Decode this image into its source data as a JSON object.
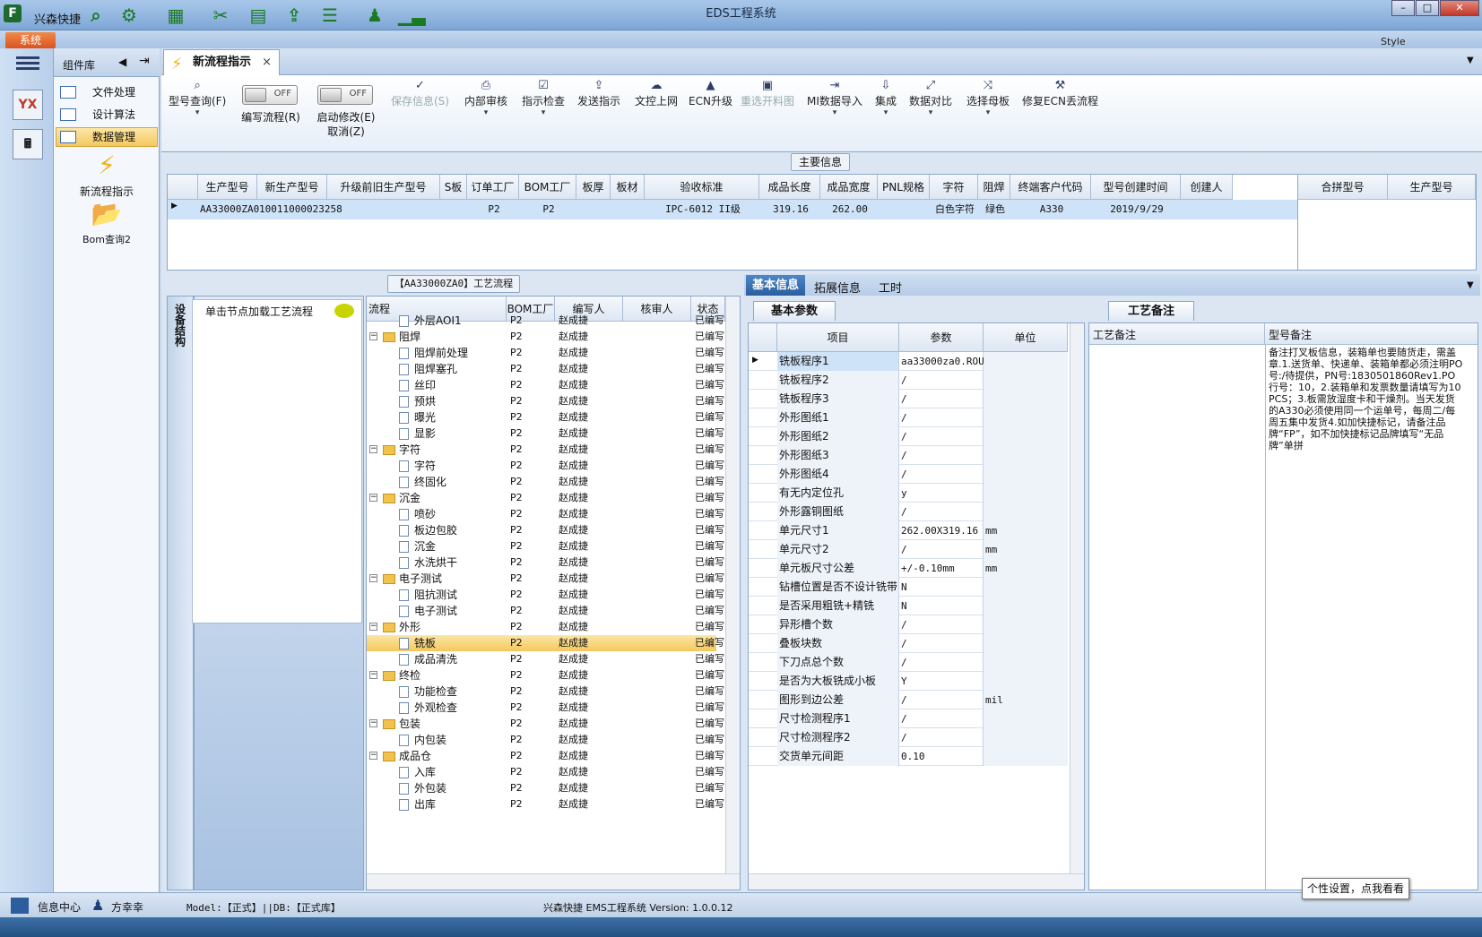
{
  "window": {
    "title": "EDS工程系统",
    "app_name": "兴森快捷",
    "sys_button": "系统",
    "style_label": "Style"
  },
  "left_nav": {
    "icons": [
      "yx-icon",
      "calculator-icon"
    ]
  },
  "component_panel": {
    "title": "组件库",
    "items": [
      {
        "label": "文件处理"
      },
      {
        "label": "设计算法"
      },
      {
        "label": "数据管理"
      }
    ],
    "big_items": [
      {
        "label": "新流程指示"
      },
      {
        "label": "Bom查询2"
      }
    ]
  },
  "doc_tab": {
    "label": "新流程指示",
    "close": "×"
  },
  "ribbon": {
    "buttons": [
      {
        "label": "型号查询(F)",
        "icon": "search-icon"
      },
      {
        "label": "保存信息(S)",
        "icon": "check-icon",
        "disabled": true
      },
      {
        "label": "内部审核",
        "icon": "printer-icon"
      },
      {
        "label": "指示检查",
        "icon": "checkbox-icon"
      },
      {
        "label": "发送指示",
        "icon": "upload-icon"
      },
      {
        "label": "文控上网",
        "icon": "cloud-icon"
      },
      {
        "label": "ECN升级",
        "icon": "ecn-icon"
      },
      {
        "label": "重选开料图",
        "icon": "image-icon",
        "disabled": true
      },
      {
        "label": "MI数据导入",
        "icon": "import-icon"
      },
      {
        "label": "集成",
        "icon": "download-icon"
      },
      {
        "label": "数据对比",
        "icon": "compare-icon"
      },
      {
        "label": "选择母板",
        "icon": "shuffle-icon"
      },
      {
        "label": "修复ECN丢流程",
        "icon": "wrench-icon"
      }
    ],
    "toggles": [
      {
        "state": "OFF",
        "label": "编写流程(R)"
      },
      {
        "state": "OFF",
        "label": "启动修改(E)",
        "label2": "取消(Z)"
      }
    ]
  },
  "main_info": {
    "section_label": "主要信息",
    "columns": [
      "生产型号",
      "新生产型号",
      "升级前旧生产型号",
      "S板",
      "订单工厂",
      "BOM工厂",
      "板厚",
      "板材",
      "验收标准",
      "成品长度",
      "成品宽度",
      "PNL规格",
      "字符",
      "阻焊",
      "终端客户代码",
      "型号创建时间",
      "创建人"
    ],
    "row": [
      "AA33000ZA0",
      "10011000023258",
      "",
      "",
      "P2",
      "P2",
      "",
      "",
      "IPC-6012 II级",
      "319.16",
      "262.00",
      "",
      "白色字符",
      "绿色",
      "A330",
      "2019/9/29",
      ""
    ],
    "side_columns": [
      "合拼型号",
      "生产型号"
    ]
  },
  "process": {
    "section_label": "【AA33000ZA0】工艺流程",
    "side_tab": "设备结构",
    "hint": "单击节点加载工艺流程",
    "columns": [
      "流程",
      "BOM工厂",
      "编写人",
      "核审人",
      "状态"
    ],
    "rows": [
      {
        "name": "外层AOI1",
        "level": 2,
        "type": "page",
        "bom": "P2",
        "author": "赵成捷",
        "reviewer": "",
        "status": "已编写"
      },
      {
        "name": "阻焊",
        "level": 1,
        "type": "folder",
        "bom": "P2",
        "author": "赵成捷",
        "reviewer": "",
        "status": "已编写"
      },
      {
        "name": "阻焊前处理",
        "level": 2,
        "type": "page",
        "bom": "P2",
        "author": "赵成捷",
        "reviewer": "",
        "status": "已编写"
      },
      {
        "name": "阻焊塞孔",
        "level": 2,
        "type": "page",
        "bom": "P2",
        "author": "赵成捷",
        "reviewer": "",
        "status": "已编写"
      },
      {
        "name": "丝印",
        "level": 2,
        "type": "page",
        "bom": "P2",
        "author": "赵成捷",
        "reviewer": "",
        "status": "已编写"
      },
      {
        "name": "预烘",
        "level": 2,
        "type": "page",
        "bom": "P2",
        "author": "赵成捷",
        "reviewer": "",
        "status": "已编写"
      },
      {
        "name": "曝光",
        "level": 2,
        "type": "page",
        "bom": "P2",
        "author": "赵成捷",
        "reviewer": "",
        "status": "已编写"
      },
      {
        "name": "显影",
        "level": 2,
        "type": "page",
        "bom": "P2",
        "author": "赵成捷",
        "reviewer": "",
        "status": "已编写"
      },
      {
        "name": "字符",
        "level": 1,
        "type": "folder",
        "bom": "P2",
        "author": "赵成捷",
        "reviewer": "",
        "status": "已编写"
      },
      {
        "name": "字符",
        "level": 2,
        "type": "page",
        "bom": "P2",
        "author": "赵成捷",
        "reviewer": "",
        "status": "已编写"
      },
      {
        "name": "终固化",
        "level": 2,
        "type": "page",
        "bom": "P2",
        "author": "赵成捷",
        "reviewer": "",
        "status": "已编写"
      },
      {
        "name": "沉金",
        "level": 1,
        "type": "folder",
        "bom": "P2",
        "author": "赵成捷",
        "reviewer": "",
        "status": "已编写"
      },
      {
        "name": "喷砂",
        "level": 2,
        "type": "page",
        "bom": "P2",
        "author": "赵成捷",
        "reviewer": "",
        "status": "已编写"
      },
      {
        "name": "板边包胶",
        "level": 2,
        "type": "page",
        "bom": "P2",
        "author": "赵成捷",
        "reviewer": "",
        "status": "已编写"
      },
      {
        "name": "沉金",
        "level": 2,
        "type": "page",
        "bom": "P2",
        "author": "赵成捷",
        "reviewer": "",
        "status": "已编写"
      },
      {
        "name": "水洗烘干",
        "level": 2,
        "type": "page",
        "bom": "P2",
        "author": "赵成捷",
        "reviewer": "",
        "status": "已编写"
      },
      {
        "name": "电子测试",
        "level": 1,
        "type": "folder",
        "bom": "P2",
        "author": "赵成捷",
        "reviewer": "",
        "status": "已编写"
      },
      {
        "name": "阻抗测试",
        "level": 2,
        "type": "page",
        "bom": "P2",
        "author": "赵成捷",
        "reviewer": "",
        "status": "已编写"
      },
      {
        "name": "电子测试",
        "level": 2,
        "type": "page",
        "bom": "P2",
        "author": "赵成捷",
        "reviewer": "",
        "status": "已编写"
      },
      {
        "name": "外形",
        "level": 1,
        "type": "folder",
        "bom": "P2",
        "author": "赵成捷",
        "reviewer": "",
        "status": "已编写"
      },
      {
        "name": "铣板",
        "level": 2,
        "type": "page",
        "bom": "P2",
        "author": "赵成捷",
        "reviewer": "",
        "status": "已编写",
        "selected": true
      },
      {
        "name": "成品清洗",
        "level": 2,
        "type": "page",
        "bom": "P2",
        "author": "赵成捷",
        "reviewer": "",
        "status": "已编写"
      },
      {
        "name": "终检",
        "level": 1,
        "type": "folder",
        "bom": "P2",
        "author": "赵成捷",
        "reviewer": "",
        "status": "已编写"
      },
      {
        "name": "功能检查",
        "level": 2,
        "type": "page",
        "bom": "P2",
        "author": "赵成捷",
        "reviewer": "",
        "status": "已编写"
      },
      {
        "name": "外观检查",
        "level": 2,
        "type": "page",
        "bom": "P2",
        "author": "赵成捷",
        "reviewer": "",
        "status": "已编写"
      },
      {
        "name": "包装",
        "level": 1,
        "type": "folder",
        "bom": "P2",
        "author": "赵成捷",
        "reviewer": "",
        "status": "已编写"
      },
      {
        "name": "内包装",
        "level": 2,
        "type": "page",
        "bom": "P2",
        "author": "赵成捷",
        "reviewer": "",
        "status": "已编写"
      },
      {
        "name": "成品仓",
        "level": 1,
        "type": "folder",
        "bom": "P2",
        "author": "赵成捷",
        "reviewer": "",
        "status": "已编写"
      },
      {
        "name": "入库",
        "level": 2,
        "type": "page",
        "bom": "P2",
        "author": "赵成捷",
        "reviewer": "",
        "status": "已编写"
      },
      {
        "name": "外包装",
        "level": 2,
        "type": "page",
        "bom": "P2",
        "author": "赵成捷",
        "reviewer": "",
        "status": "已编写"
      },
      {
        "name": "出库",
        "level": 2,
        "type": "page",
        "bom": "P2",
        "author": "赵成捷",
        "reviewer": "",
        "status": "已编写"
      }
    ]
  },
  "detail_tabs": [
    "基本信息",
    "拓展信息",
    "工时"
  ],
  "basic_params": {
    "tab": "基本参数",
    "columns": [
      "项目",
      "参数",
      "单位"
    ],
    "rows": [
      {
        "k": "铣板程序1",
        "v": "aa33000za0.ROU",
        "u": "",
        "sel": true
      },
      {
        "k": "铣板程序2",
        "v": "/",
        "u": ""
      },
      {
        "k": "铣板程序3",
        "v": "/",
        "u": ""
      },
      {
        "k": "外形图纸1",
        "v": "/",
        "u": ""
      },
      {
        "k": "外形图纸2",
        "v": "/",
        "u": ""
      },
      {
        "k": "外形图纸3",
        "v": "/",
        "u": ""
      },
      {
        "k": "外形图纸4",
        "v": "/",
        "u": ""
      },
      {
        "k": "有无内定位孔",
        "v": "y",
        "u": ""
      },
      {
        "k": "外形露铜图纸",
        "v": "/",
        "u": ""
      },
      {
        "k": "单元尺寸1",
        "v": "262.00X319.16",
        "u": "mm"
      },
      {
        "k": "单元尺寸2",
        "v": "/",
        "u": "mm"
      },
      {
        "k": "单元板尺寸公差",
        "v": "+/-0.10mm",
        "u": "mm"
      },
      {
        "k": "钻槽位置是否不设计铣带",
        "v": "N",
        "u": ""
      },
      {
        "k": "是否采用粗铣+精铣",
        "v": "N",
        "u": ""
      },
      {
        "k": "异形槽个数",
        "v": "/",
        "u": ""
      },
      {
        "k": "叠板块数",
        "v": "/",
        "u": ""
      },
      {
        "k": "下刀点总个数",
        "v": "/",
        "u": ""
      },
      {
        "k": "是否为大板铣成小板",
        "v": "Y",
        "u": ""
      },
      {
        "k": "图形到边公差",
        "v": "/",
        "u": "mil"
      },
      {
        "k": "尺寸检测程序1",
        "v": "/",
        "u": ""
      },
      {
        "k": "尺寸检测程序2",
        "v": "/",
        "u": ""
      },
      {
        "k": "交货单元间距",
        "v": "0.10",
        "u": ""
      }
    ]
  },
  "remarks": {
    "tab": "工艺备注",
    "col1": "工艺备注",
    "col2": "型号备注",
    "model_note": "备注打叉板信息，装箱单也要随货走，需盖章.1.送货单、快递单、装箱单都必须注明PO号:/待提供，PN号:1830501860Rev1.PO行号：10，2.装箱单和发票数量请填写为10PCS；3.板需放湿度卡和干燥剂。当天发货的A330必须使用同一个运单号，每周二/每周五集中发货4.如加快捷标记，请备注品牌“FP”，如不加快捷标记品牌填写“无品牌”单拼"
  },
  "status": {
    "info_center": "信息中心",
    "user": "方幸幸",
    "model_db": "Model:【正式】||DB:【正式库】",
    "system": "兴森快捷 EMS工程系统 Version: 1.0.0.12",
    "tooltip": "个性设置，点我看看"
  }
}
